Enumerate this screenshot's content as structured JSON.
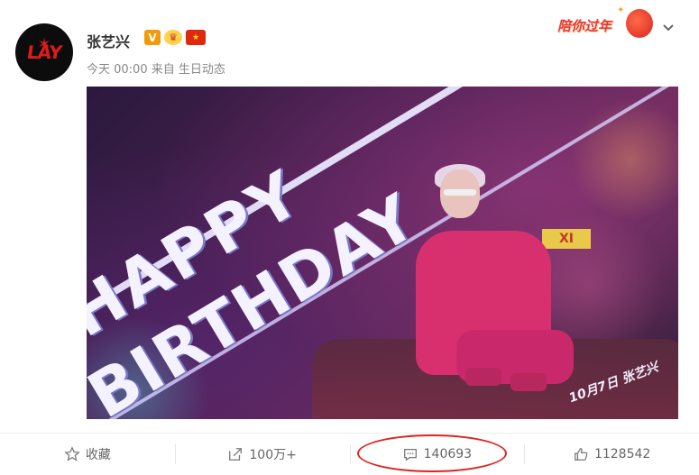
{
  "user": {
    "name": "张艺兴",
    "avatar_text": "LAY",
    "badges": [
      "verified-badge",
      "crown-badge",
      "china-flag-badge"
    ]
  },
  "post": {
    "time": "今天 00:00",
    "source_prefix": "来自",
    "source": "生日动态"
  },
  "festival": {
    "text": "陪你过年",
    "icon": "lantern-icon"
  },
  "image": {
    "headline_top": "HAPPY",
    "headline_bottom": "BIRTHDAY",
    "sign": "XI",
    "caption": "10月7日 张艺兴"
  },
  "actions": {
    "favorite": {
      "icon": "star-icon",
      "label": "收藏"
    },
    "repost": {
      "icon": "share-icon",
      "label": "100万+"
    },
    "comment": {
      "icon": "comment-icon",
      "label": "140693"
    },
    "like": {
      "icon": "thumbs-up-icon",
      "label": "1128542"
    }
  },
  "colors": {
    "highlight_circle": "#e0231f",
    "festival_red": "#e4393c",
    "verified_orange": "#f39a0b"
  }
}
